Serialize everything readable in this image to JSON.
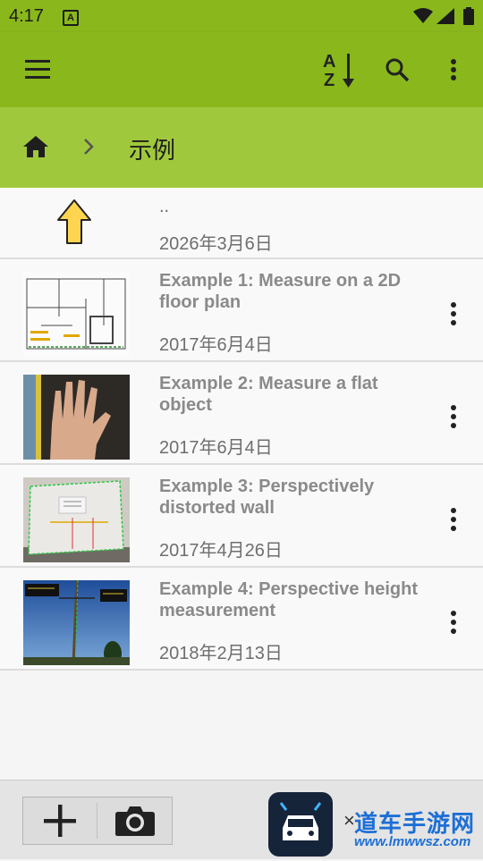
{
  "status_bar": {
    "time": "4:17",
    "notification_badge": "A"
  },
  "toolbar": {
    "menu_icon": "menu-icon",
    "sort_icon": "sort-az-icon",
    "sort_letters": [
      "A",
      "Z"
    ],
    "search_icon": "search-icon",
    "overflow_icon": "more-vert-icon"
  },
  "breadcrumb": {
    "home_icon": "home-icon",
    "separator_icon": "chevron-right-icon",
    "current": "示例"
  },
  "parent": {
    "label": "..",
    "date": "2026年3月6日"
  },
  "items": [
    {
      "title": "Example 1: Measure on a 2D floor plan",
      "date": "2017年6月4日",
      "thumb": "floor-plan"
    },
    {
      "title": "Example 2: Measure a flat object",
      "date": "2017年6月4日",
      "thumb": "hand"
    },
    {
      "title": "Example 3: Perspectively distorted wall",
      "date": "2017年4月26日",
      "thumb": "wall"
    },
    {
      "title": "Example 4: Perspective height measurement",
      "date": "2018年2月13日",
      "thumb": "pole"
    }
  ],
  "bottom_bar": {
    "add_icon": "plus-icon",
    "camera_icon": "camera-icon"
  },
  "watermark": {
    "text": "道车手游网",
    "url": "www.lmwwsz.com",
    "close": "×"
  },
  "colors": {
    "toolbar": "#8ab81c",
    "breadcrumb_bg": "#a0c83c",
    "title_text": "#8a8a8a",
    "date_text": "#6e6e6e",
    "arrow_fill": "#ffd54f"
  }
}
